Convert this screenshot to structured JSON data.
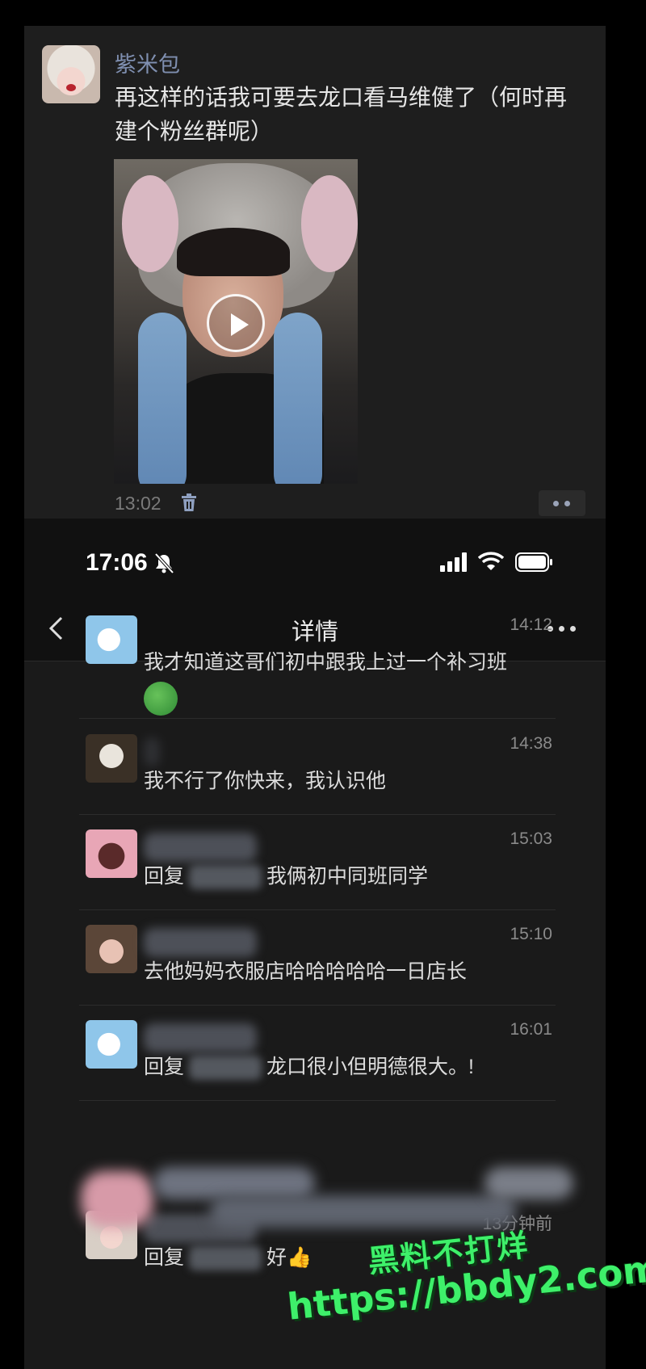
{
  "post": {
    "author": "紫米包",
    "text": "再这样的话我可要去龙口看马维健了（何时再建个粉丝群呢）",
    "time": "13:02"
  },
  "status_bar": {
    "time": "17:06"
  },
  "nav": {
    "title": "详情"
  },
  "comments": [
    {
      "time": "14:12",
      "text": "我才知道这哥们初中跟我上过一个补习班"
    },
    {
      "time": "14:38",
      "text": "我不行了你快来，我认识他"
    },
    {
      "time": "15:03",
      "text_prefix": "回复",
      "text": "我俩初中同班同学"
    },
    {
      "time": "15:10",
      "text": "去他妈妈衣服店哈哈哈哈哈一日店长"
    },
    {
      "time": "16:01",
      "text_prefix": "回复",
      "text": "龙口很小但明德很大。!"
    },
    {
      "time": "13分钟前",
      "text_prefix": "回复",
      "text": "好👍"
    }
  ],
  "watermark": {
    "line1": "黑料不打烊",
    "line2": "https://bbdy2.com"
  },
  "colors": {
    "background": "#000000",
    "card": "#1e1e1e",
    "author": "#7f8fb0",
    "watermark": "#3ef06a"
  }
}
